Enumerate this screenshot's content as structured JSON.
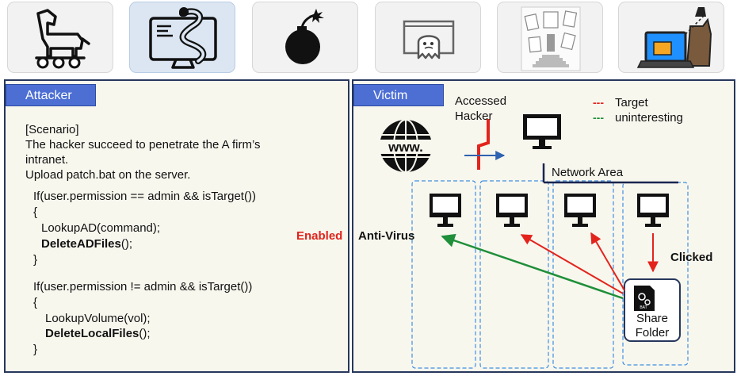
{
  "toolbar": {
    "icons": [
      "trojan-horse-icon",
      "worm-monitor-icon",
      "bomb-icon",
      "ghost-screen-icon",
      "document-stairs-icon",
      "hacker-laptop-icon"
    ],
    "active_icon": "worm-monitor-icon"
  },
  "attacker": {
    "tag": "Attacker",
    "scenario_lines": [
      "[Scenario]",
      "The hacker succeed to penetrate the A firm’s",
      "intranet.",
      "Upload patch.bat on the server."
    ],
    "code1": {
      "condition": "If(user.permission == admin && isTarget())",
      "open": "{",
      "line1": "LookupAD(command);",
      "line2_bold": "DeleteADFiles",
      "line2_rest": "();",
      "close": "}"
    },
    "code2": {
      "condition": "If(user.permission != admin && isTarget())",
      "open": "{",
      "line1": "LookupVolume(vol);",
      "line2_bold": "DeleteLocalFiles",
      "line2_rest": "();",
      "close": "}"
    }
  },
  "victim": {
    "tag": "Victim",
    "accessed_label_1": "Accessed",
    "accessed_label_2": "Hacker",
    "www_label": "www.",
    "legend": {
      "target_dash": "---",
      "target_label": "Target",
      "uninteresting_dash": "---",
      "uninteresting_label": "uninteresting"
    },
    "network_area_label": "Network Area",
    "enabled_label": "Enabled",
    "antivirus_label": "Anti-Virus",
    "clicked_label": "Clicked",
    "share_folder_label_1": "Share",
    "share_folder_label_2": "Folder",
    "bat_label": "BAT"
  },
  "colors": {
    "panel_border": "#27375c",
    "tag_blue": "#4d6fd4",
    "target_red": "#e3241c",
    "uninteresting_green": "#1f8f3a",
    "arrow_blue": "#2f62b0",
    "enabled_red": "#e0241c",
    "zone_dash_blue": "#3f8ee0"
  }
}
